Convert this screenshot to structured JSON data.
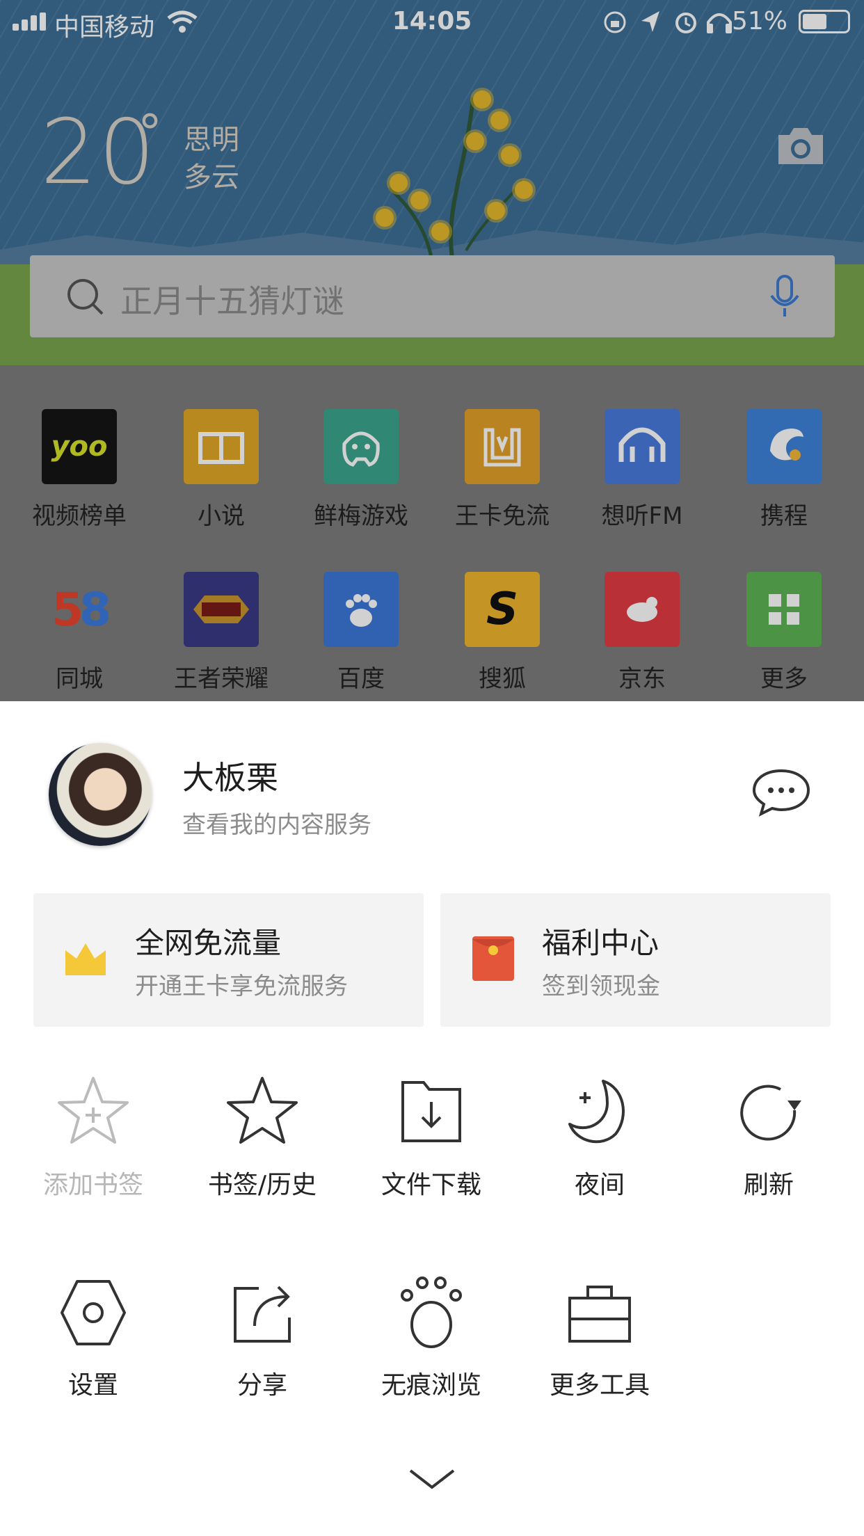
{
  "status_bar": {
    "carrier": "中国移动",
    "time": "14:05",
    "battery": "51%"
  },
  "weather": {
    "temperature": "20",
    "degree": "°",
    "city": "思明",
    "condition": "多云"
  },
  "search": {
    "placeholder": "正月十五猜灯谜"
  },
  "apps": [
    {
      "label": "视频榜单",
      "icon": "yoo-icon",
      "color": "#151515"
    },
    {
      "label": "小说",
      "icon": "book-icon",
      "color": "#e0a825"
    },
    {
      "label": "鲜梅游戏",
      "icon": "game-icon",
      "color": "#3aa58e"
    },
    {
      "label": "王卡免流",
      "icon": "wangka-icon",
      "color": "#e2a02a"
    },
    {
      "label": "想听FM",
      "icon": "fm-icon",
      "color": "#4a7bdc"
    },
    {
      "label": "携程",
      "icon": "dolphin-icon",
      "color": "#3f83d9"
    },
    {
      "label": "同城",
      "icon": "58-icon",
      "color": "#ffffff"
    },
    {
      "label": "王者荣耀",
      "icon": "honor-of-kings-icon",
      "color": "#3b3a86"
    },
    {
      "label": "百度",
      "icon": "paw-icon",
      "color": "#3c78d8"
    },
    {
      "label": "搜狐",
      "icon": "sohu-icon",
      "color": "#f0b62c"
    },
    {
      "label": "京东",
      "icon": "jd-icon",
      "color": "#e23b43"
    },
    {
      "label": "更多",
      "icon": "grid-icon",
      "color": "#5fb456"
    }
  ],
  "profile": {
    "name": "大板栗",
    "subtitle": "查看我的内容服务"
  },
  "cards": [
    {
      "title": "全网免流量",
      "subtitle": "开通王卡享免流服务",
      "icon": "crown-icon"
    },
    {
      "title": "福利中心",
      "subtitle": "签到领现金",
      "icon": "red-packet-icon"
    }
  ],
  "tools_row1": [
    {
      "label": "添加书签",
      "icon": "add-bookmark-icon",
      "disabled": true
    },
    {
      "label": "书签/历史",
      "icon": "star-icon"
    },
    {
      "label": "文件下载",
      "icon": "download-folder-icon"
    },
    {
      "label": "夜间",
      "icon": "moon-icon"
    },
    {
      "label": "刷新",
      "icon": "refresh-icon"
    }
  ],
  "tools_row2": [
    {
      "label": "设置",
      "icon": "settings-icon"
    },
    {
      "label": "分享",
      "icon": "share-icon"
    },
    {
      "label": "无痕浏览",
      "icon": "paw-print-icon"
    },
    {
      "label": "更多工具",
      "icon": "toolbox-icon"
    }
  ]
}
